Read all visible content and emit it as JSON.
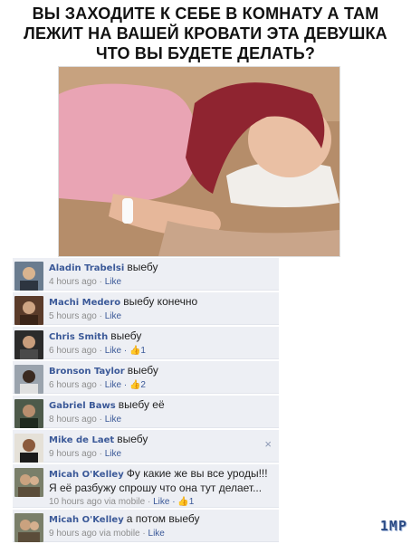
{
  "headline": {
    "line1": "ВЫ ЗАХОДИТЕ К СЕБЕ В КОМНАТУ А ТАМ",
    "line2": "ЛЕЖИТ НА ВАШЕЙ КРОВАТИ ЭТА ДЕВУШКА",
    "line3": "ЧТО ВЫ БУДЕТЕ ДЕЛАТЬ?"
  },
  "comments": [
    {
      "author": "Aladin Trabelsi",
      "text": "выебу",
      "meta": "4 hours ago · ",
      "like": "Like",
      "likes": ""
    },
    {
      "author": "Machi Medero",
      "text": "выебу конечно",
      "meta": "5 hours ago · ",
      "like": "Like",
      "likes": ""
    },
    {
      "author": "Chris Smith",
      "text": "выебу",
      "meta": "6 hours ago · ",
      "like": "Like",
      "likes": " · 👍1"
    },
    {
      "author": "Bronson Taylor",
      "text": "выебу",
      "meta": "6 hours ago · ",
      "like": "Like",
      "likes": " · 👍2"
    },
    {
      "author": "Gabriel Baws",
      "text": "выебу её",
      "meta": "8 hours ago · ",
      "like": "Like",
      "likes": ""
    },
    {
      "author": "Mike de Laet",
      "text": "выебу",
      "meta": "9 hours ago · ",
      "like": "Like",
      "likes": ""
    },
    {
      "author": "Micah O'Kelley",
      "text": "Фу какие же вы все уроды!!! Я её разбужу спрошу что она тут делает...",
      "meta": "10 hours ago via mobile · ",
      "like": "Like",
      "likes": " · 👍1"
    },
    {
      "author": "Micah O'Kelley",
      "text": "а потом выебу",
      "meta": "9 hours ago via mobile · ",
      "like": "Like",
      "likes": ""
    }
  ],
  "close_icon": "×",
  "watermark": "1MP",
  "colors": {
    "link": "#3b5998",
    "comment_bg": "#edeff4"
  }
}
